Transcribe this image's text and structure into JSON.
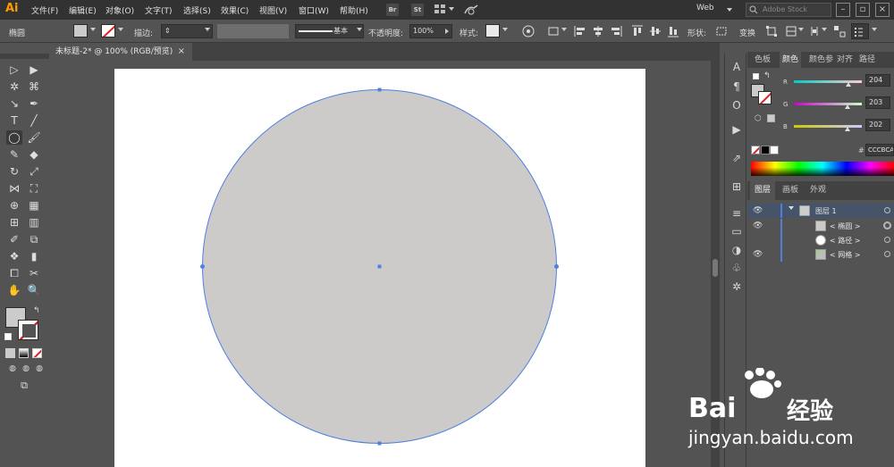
{
  "menubar": {
    "logo": "Ai",
    "menus": [
      "文件(F)",
      "编辑(E)",
      "对象(O)",
      "文字(T)",
      "选择(S)",
      "效果(C)",
      "视图(V)",
      "窗口(W)",
      "帮助(H)"
    ],
    "app_icons": [
      "Br",
      "St"
    ],
    "workspace": "Web",
    "search_placeholder": "Adobe Stock"
  },
  "controlbar": {
    "selection_type": "椭圆",
    "stroke_label": "描边:",
    "stroke_style": "基本",
    "opacity_label": "不透明度:",
    "opacity_value": "100%",
    "style_label": "样式:",
    "shape_label": "形状:",
    "transform_label": "变换"
  },
  "document_tab": {
    "title": "未标题-2* @ 100% (RGB/预览)",
    "close": "×"
  },
  "color_panel": {
    "tabs": [
      "色板",
      "颜色",
      "颜色参",
      "对齐",
      "路径"
    ],
    "active_tab": "颜色",
    "channels": [
      {
        "label": "R",
        "value": "204",
        "fraction": 0.8
      },
      {
        "label": "G",
        "value": "203",
        "fraction": 0.796
      },
      {
        "label": "B",
        "value": "202",
        "fraction": 0.792
      }
    ],
    "hex_label": "#",
    "hex_value": "CCCBCA"
  },
  "layers_panel": {
    "tabs": [
      "图层",
      "画板",
      "外观"
    ],
    "active_tab": "图层",
    "rows": [
      {
        "name": "图层 1",
        "visible": true
      },
      {
        "name": "< 椭圆 >",
        "visible": true
      },
      {
        "name": "< 路径 >",
        "visible": false
      },
      {
        "name": "< 网格 >",
        "visible": true
      }
    ]
  },
  "canvas": {
    "fill_color": "#CCCBCA",
    "path_color": "#4f7fe0"
  },
  "watermark": {
    "brand": "Bai",
    "brand_cn": "经验",
    "url": "jingyan.baidu.com"
  }
}
